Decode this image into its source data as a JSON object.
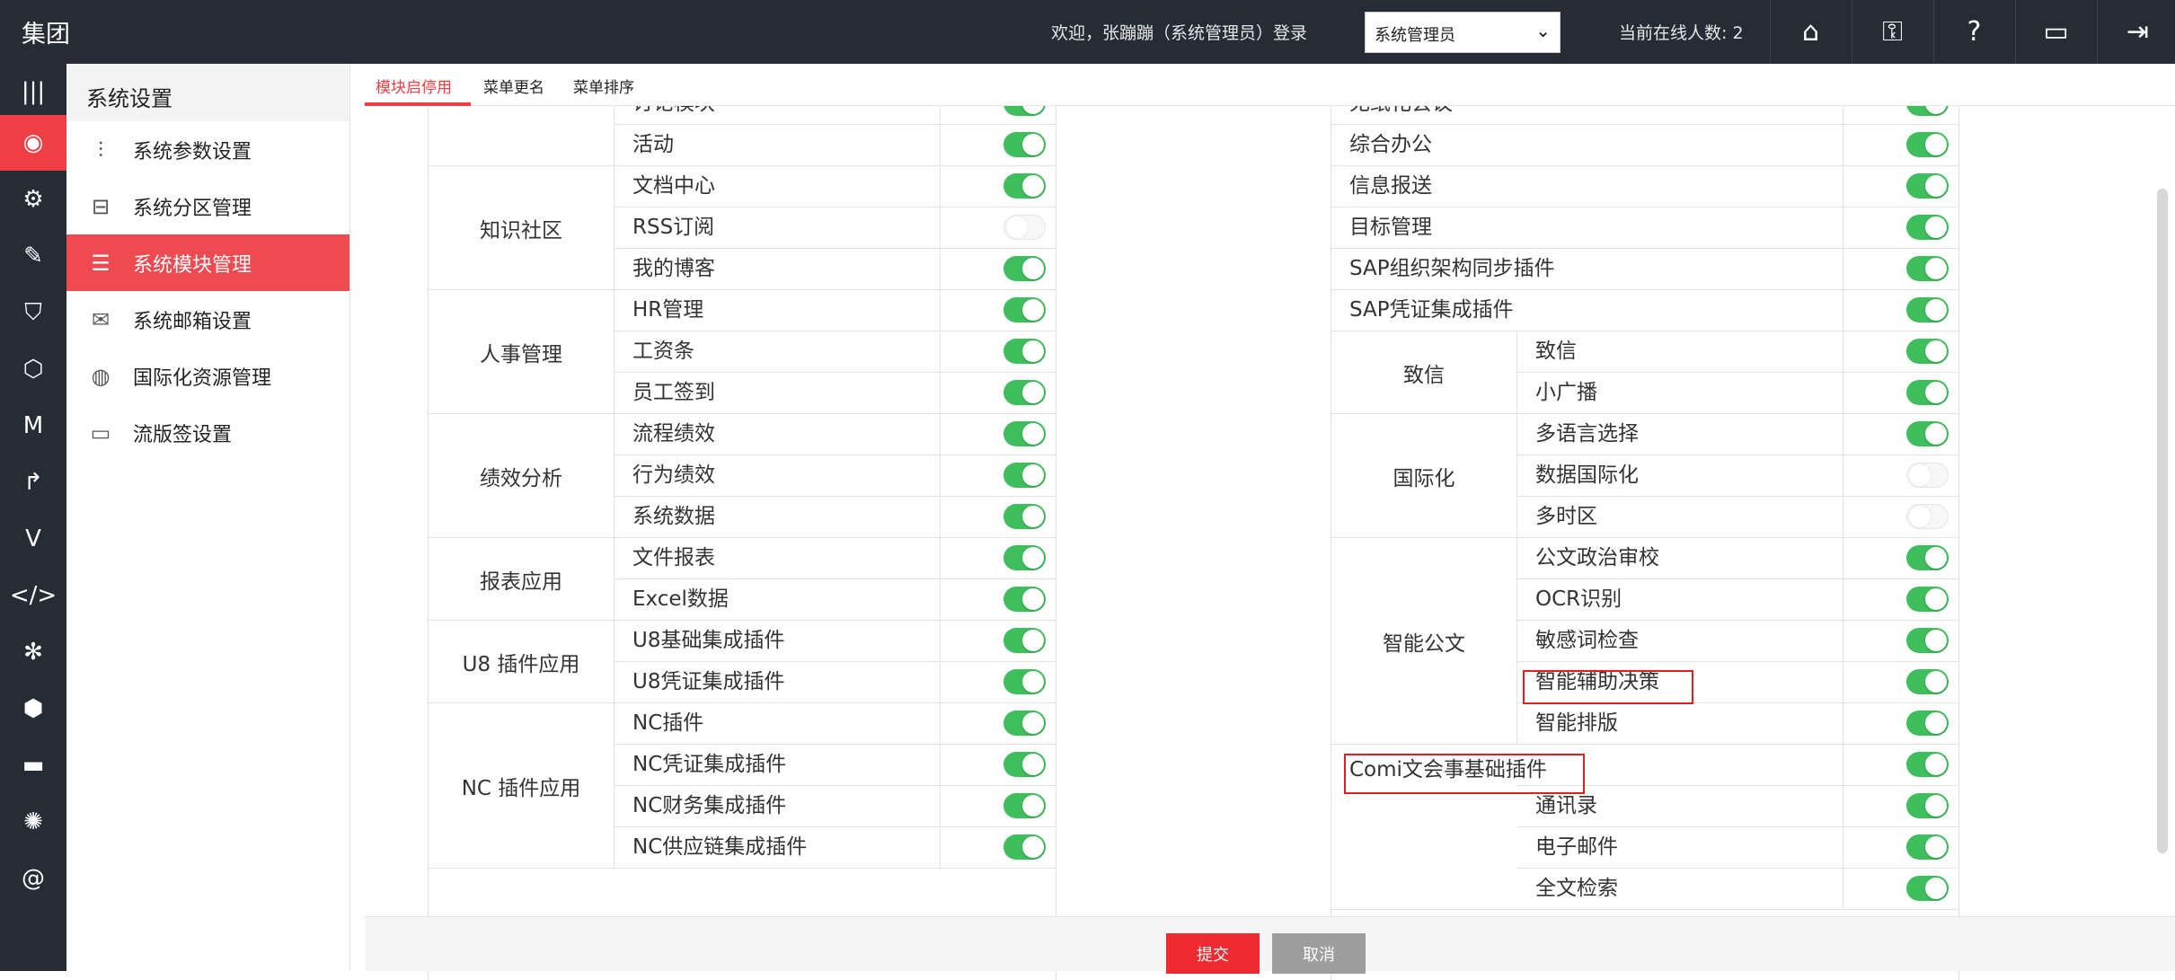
{
  "header": {
    "brand": "集团",
    "welcome": "欢迎，张蹦蹦（系统管理员）登录",
    "role_select": "系统管理员",
    "online": "当前在线人数: 2",
    "icons": [
      "home-icon",
      "key-icon",
      "help-icon",
      "monitor-icon",
      "logout-icon"
    ]
  },
  "rail": [
    "menu-icon",
    "dashboard-icon",
    "gear-icon",
    "plugin-icon",
    "shield-icon",
    "hexagon-icon",
    "m-icon",
    "share-icon",
    "v-icon",
    "code-icon",
    "settings-icon",
    "cube-icon",
    "screen-icon",
    "bulb-icon",
    "at-icon"
  ],
  "sidenav": {
    "title": "系统设置",
    "items": [
      {
        "label": "系统参数设置",
        "icon": "sliders-icon"
      },
      {
        "label": "系统分区管理",
        "icon": "drive-icon"
      },
      {
        "label": "系统模块管理",
        "icon": "list-icon"
      },
      {
        "label": "系统邮箱设置",
        "icon": "mail-icon"
      },
      {
        "label": "国际化资源管理",
        "icon": "globe-icon"
      },
      {
        "label": "流版签设置",
        "icon": "display-icon"
      }
    ]
  },
  "tabs": [
    "模块启停用",
    "菜单更名",
    "菜单排序"
  ],
  "left_table": {
    "groups": [
      {
        "category": "",
        "rows": [
          {
            "name": "讨论模块",
            "on": true
          },
          {
            "name": "活动",
            "on": true
          }
        ]
      },
      {
        "category": "知识社区",
        "rows": [
          {
            "name": "文档中心",
            "on": true
          },
          {
            "name": "RSS订阅",
            "on": false
          },
          {
            "name": "我的博客",
            "on": true
          }
        ]
      },
      {
        "category": "人事管理",
        "rows": [
          {
            "name": "HR管理",
            "on": true
          },
          {
            "name": "工资条",
            "on": true
          },
          {
            "name": "员工签到",
            "on": true
          }
        ]
      },
      {
        "category": "绩效分析",
        "rows": [
          {
            "name": "流程绩效",
            "on": true
          },
          {
            "name": "行为绩效",
            "on": true
          },
          {
            "name": "系统数据",
            "on": true
          }
        ]
      },
      {
        "category": "报表应用",
        "rows": [
          {
            "name": "文件报表",
            "on": true
          },
          {
            "name": "Excel数据",
            "on": true
          }
        ]
      },
      {
        "category": "U8 插件应用",
        "rows": [
          {
            "name": "U8基础集成插件",
            "on": true
          },
          {
            "name": "U8凭证集成插件",
            "on": true
          }
        ]
      },
      {
        "category": "NC 插件应用",
        "rows": [
          {
            "name": "NC插件",
            "on": true
          },
          {
            "name": "NC凭证集成插件",
            "on": true
          },
          {
            "name": "NC财务集成插件",
            "on": true
          },
          {
            "name": "NC供应链集成插件",
            "on": true
          }
        ]
      }
    ]
  },
  "right_table": {
    "singles": [
      {
        "name": "无纸化会议",
        "on": true
      },
      {
        "name": "综合办公",
        "on": true
      },
      {
        "name": "信息报送",
        "on": true
      },
      {
        "name": "目标管理",
        "on": true
      },
      {
        "name": "SAP组织架构同步插件",
        "on": true
      },
      {
        "name": "SAP凭证集成插件",
        "on": true
      }
    ],
    "groups": [
      {
        "category": "致信",
        "rows": [
          {
            "name": "致信",
            "on": true
          },
          {
            "name": "小广播",
            "on": true
          }
        ]
      },
      {
        "category": "国际化",
        "rows": [
          {
            "name": "多语言选择",
            "on": true
          },
          {
            "name": "数据国际化",
            "on": false
          },
          {
            "name": "多时区",
            "on": false
          }
        ]
      },
      {
        "category": "智能公文",
        "rows": [
          {
            "name": "公文政治审校",
            "on": true
          },
          {
            "name": "OCR识别",
            "on": true
          },
          {
            "name": "敏感词检查",
            "on": true
          },
          {
            "name": "智能辅助决策",
            "on": true
          },
          {
            "name": "智能排版",
            "on": true
          }
        ]
      },
      {
        "category": "Comi文会事基础插件",
        "rows": [
          {
            "name": "",
            "on": true
          },
          {
            "name": "通讯录",
            "on": true
          },
          {
            "name": "电子邮件",
            "on": true
          },
          {
            "name": "全文检索",
            "on": true
          }
        ]
      }
    ]
  },
  "footer": {
    "submit": "提交",
    "cancel": "取消"
  }
}
